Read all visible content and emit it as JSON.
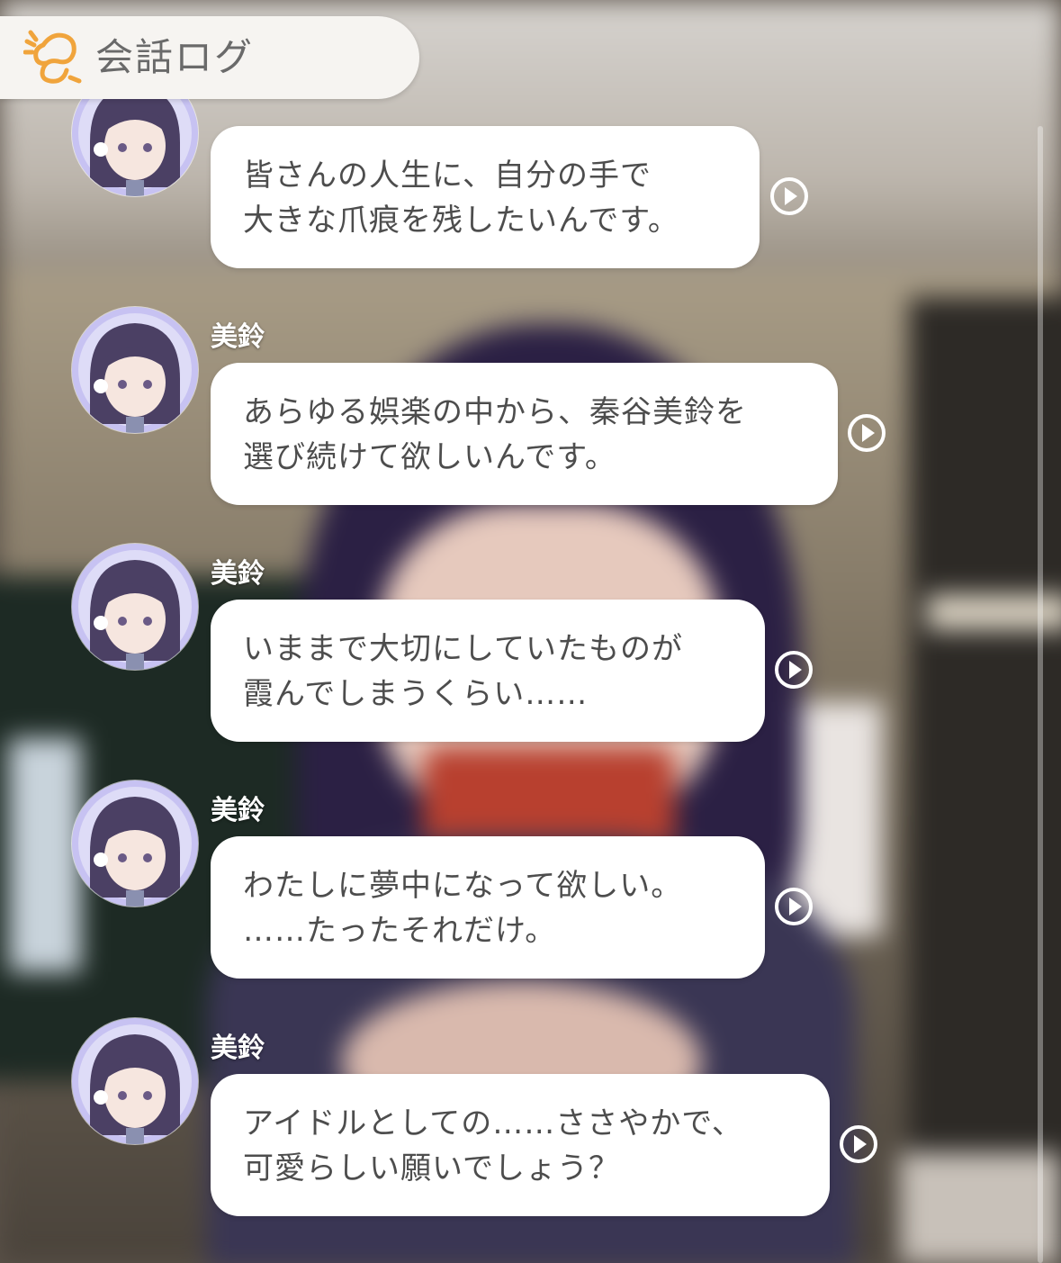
{
  "header": {
    "title": "会話ログ",
    "icon": "flower-leaf-icon",
    "accent": "#f0a43c"
  },
  "colors": {
    "bubble": "#ffffff",
    "text": "#4d4d4d",
    "avatar_ring": "#c9c4f0"
  },
  "messages": [
    {
      "speaker": "",
      "lines": [
        "皆さんの人生に、自分の手で",
        "大きな爪痕を残したいんです。"
      ]
    },
    {
      "speaker": "美鈴",
      "lines": [
        "あらゆる娯楽の中から、秦谷美鈴を",
        "選び続けて欲しいんです。"
      ]
    },
    {
      "speaker": "美鈴",
      "lines": [
        "いままで大切にしていたものが",
        "霞んでしまうくらい……"
      ]
    },
    {
      "speaker": "美鈴",
      "lines": [
        "わたしに夢中になって欲しい。",
        "……たったそれだけ。"
      ]
    },
    {
      "speaker": "美鈴",
      "lines": [
        "アイドルとしての……ささやかで、",
        "可愛らしい願いでしょう？"
      ]
    }
  ]
}
